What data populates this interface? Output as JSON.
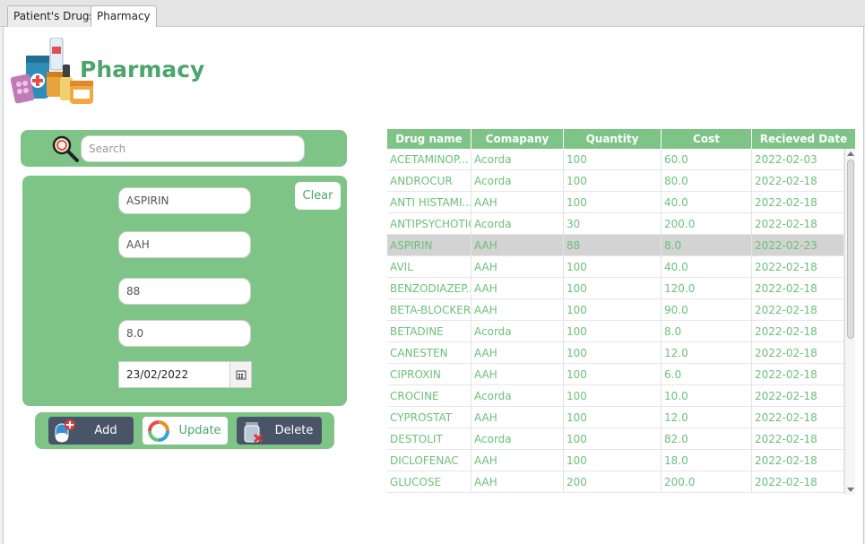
{
  "tabs": [
    {
      "label": "Patient's Drugs",
      "active": false
    },
    {
      "label": "Pharmacy",
      "active": true
    }
  ],
  "page_title": "Pharmacy",
  "search": {
    "placeholder": "Search",
    "value": ""
  },
  "form": {
    "drug_name": "ASPIRIN",
    "company": "AAH",
    "quantity": "88",
    "cost": "8.0",
    "date": "23/02/2022",
    "clear_label": "Clear"
  },
  "buttons": {
    "add": "Add",
    "update": "Update",
    "delete": "Delete"
  },
  "colors": {
    "accent": "#7dc486",
    "accent_text": "#4ca56c",
    "button_dark": "#4a5469"
  },
  "table": {
    "columns": [
      "Drug name",
      "Comapany",
      "Quantity",
      "Cost",
      "Recieved Date"
    ],
    "selected_row": 4,
    "rows": [
      [
        "ACETAMINOP...",
        "Acorda",
        "100",
        "60.0",
        "2022-02-03"
      ],
      [
        "ANDROCUR",
        "Acorda",
        "100",
        "80.0",
        "2022-02-18"
      ],
      [
        "ANTI HISTAMI...",
        "AAH",
        "100",
        "40.0",
        "2022-02-18"
      ],
      [
        "ANTIPSYCHOTIC",
        "Acorda",
        "30",
        "200.0",
        "2022-02-18"
      ],
      [
        "ASPIRIN",
        "AAH",
        "88",
        "8.0",
        "2022-02-23"
      ],
      [
        "AVIL",
        "AAH",
        "100",
        "40.0",
        "2022-02-18"
      ],
      [
        "BENZODIAZEP...",
        "AAH",
        "100",
        "120.0",
        "2022-02-18"
      ],
      [
        "BETA-BLOCKER",
        "AAH",
        "100",
        "90.0",
        "2022-02-18"
      ],
      [
        "BETADINE",
        "Acorda",
        "100",
        "8.0",
        "2022-02-18"
      ],
      [
        "CANESTEN",
        "AAH",
        "100",
        "12.0",
        "2022-02-18"
      ],
      [
        "CIPROXIN",
        "AAH",
        "100",
        "6.0",
        "2022-02-18"
      ],
      [
        "CROCINE",
        "Acorda",
        "100",
        "10.0",
        "2022-02-18"
      ],
      [
        "CYPROSTAT",
        "AAH",
        "100",
        "12.0",
        "2022-02-18"
      ],
      [
        "DESTOLIT",
        "Acorda",
        "100",
        "82.0",
        "2022-02-18"
      ],
      [
        "DICLOFENAC",
        "AAH",
        "100",
        "18.0",
        "2022-02-18"
      ],
      [
        "GLUCOSE",
        "AAH",
        "200",
        "200.0",
        "2022-02-18"
      ]
    ]
  }
}
